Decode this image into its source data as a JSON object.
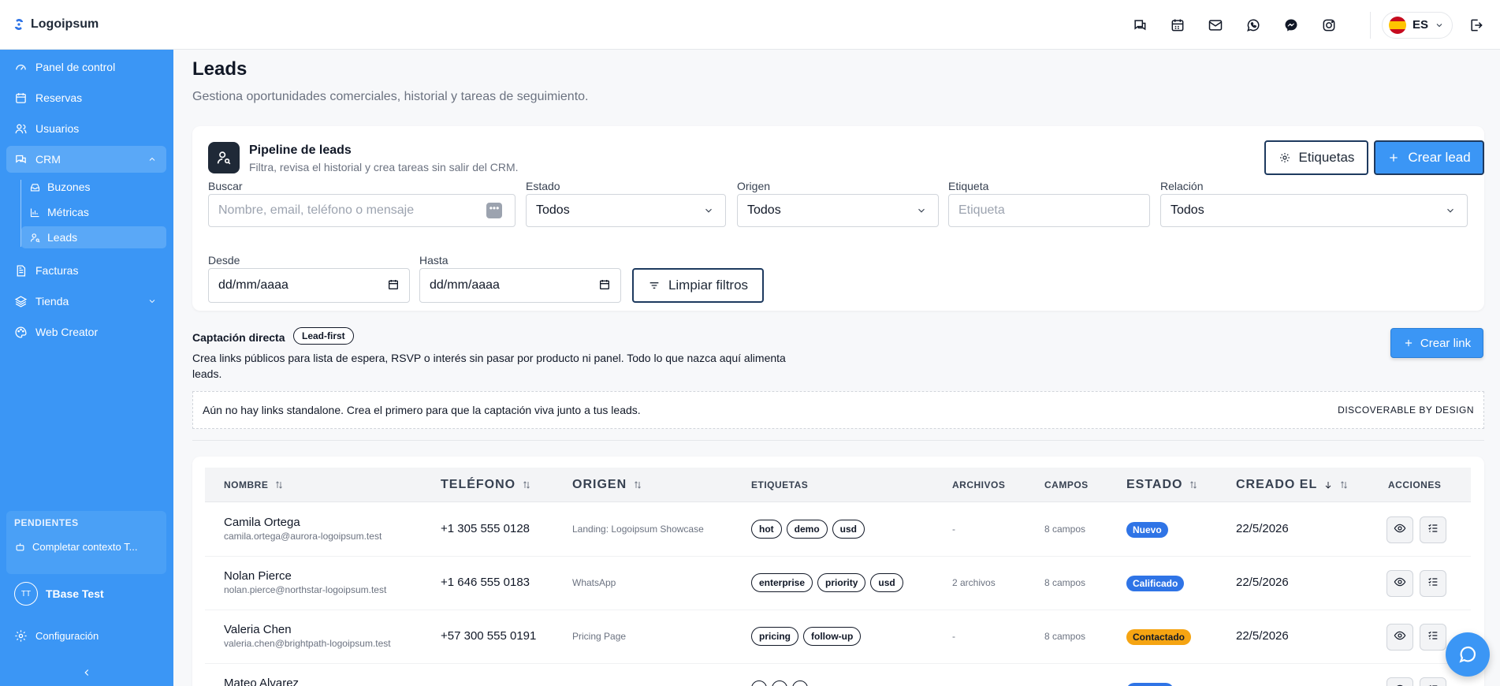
{
  "brand": {
    "name": "Logoipsum"
  },
  "topbar": {
    "icons": [
      "chat-icon",
      "calendar-icon",
      "mail-icon",
      "whatsapp-icon",
      "messenger-icon",
      "instagram-icon"
    ],
    "language": "ES"
  },
  "sidebar": {
    "items": [
      {
        "label": "Panel de control",
        "icon": "dashboard-icon"
      },
      {
        "label": "Reservas",
        "icon": "calendar-icon"
      },
      {
        "label": "Usuarios",
        "icon": "users-icon"
      },
      {
        "label": "CRM",
        "icon": "crm-icon"
      },
      {
        "label": "Facturas",
        "icon": "invoice-icon"
      },
      {
        "label": "Tienda",
        "icon": "store-icon"
      },
      {
        "label": "Web Creator",
        "icon": "palette-icon"
      }
    ],
    "crm_sub": [
      {
        "label": "Buzones"
      },
      {
        "label": "Métricas"
      },
      {
        "label": "Leads"
      }
    ],
    "pending_title": "PENDIENTES",
    "pending_item": "Completar contexto T...",
    "user_initials": "TT",
    "user_name": "TBase Test",
    "settings": "Configuración"
  },
  "page": {
    "title": "Leads",
    "subtitle": "Gestiona oportunidades comerciales, historial y tareas de seguimiento."
  },
  "pipeline": {
    "title": "Pipeline de leads",
    "subtitle": "Filtra, revisa el historial y crea tareas sin salir del CRM.",
    "tags_button": "Etiquetas",
    "create_button": "Crear lead",
    "filters": {
      "search_label": "Buscar",
      "search_placeholder": "Nombre, email, teléfono o mensaje",
      "estado_label": "Estado",
      "estado_value": "Todos",
      "origen_label": "Origen",
      "origen_value": "Todos",
      "etiqueta_label": "Etiqueta",
      "etiqueta_placeholder": "Etiqueta",
      "relacion_label": "Relación",
      "relacion_value": "Todos",
      "desde_label": "Desde",
      "desde_value": "dd/mm/aaaa",
      "hasta_label": "Hasta",
      "hasta_value": "dd/mm/aaaa",
      "clear_button": "Limpiar filtros"
    }
  },
  "captacion": {
    "title": "Captación directa",
    "badge": "Lead-first",
    "description": "Crea links públicos para lista de espera, RSVP o interés sin pasar por producto ni panel. Todo lo que nazca aquí alimenta leads.",
    "button": "Crear link",
    "empty_text": "Aún no hay links standalone. Crea el primero para que la captación viva junto a tus leads.",
    "empty_tag": "DISCOVERABLE BY DESIGN"
  },
  "table": {
    "headers": {
      "nombre": "NOMBRE",
      "telefono": "TELÉFONO",
      "origen": "ORIGEN",
      "etiquetas": "ETIQUETAS",
      "archivos": "ARCHIVOS",
      "campos": "CAMPOS",
      "estado": "ESTADO",
      "creado": "CREADO EL",
      "acciones": "ACCIONES"
    },
    "rows": [
      {
        "name": "Camila Ortega",
        "email": "camila.ortega@aurora-logoipsum.test",
        "phone": "+1 305 555 0128",
        "origin": "Landing: Logoipsum Showcase",
        "tags": [
          "hot",
          "demo",
          "usd"
        ],
        "files": "-",
        "fields": "8 campos",
        "status": "Nuevo",
        "status_color": "#2f74e6",
        "status_text_color": "#ffffff",
        "created": "22/5/2026"
      },
      {
        "name": "Nolan Pierce",
        "email": "nolan.pierce@northstar-logoipsum.test",
        "phone": "+1 646 555 0183",
        "origin": "WhatsApp",
        "tags": [
          "enterprise",
          "priority",
          "usd"
        ],
        "files": "2 archivos",
        "fields": "8 campos",
        "status": "Calificado",
        "status_color": "#2f74e6",
        "status_text_color": "#ffffff",
        "created": "22/5/2026"
      },
      {
        "name": "Valeria Chen",
        "email": "valeria.chen@brightpath-logoipsum.test",
        "phone": "+57 300 555 0191",
        "origin": "Pricing Page",
        "tags": [
          "pricing",
          "follow-up"
        ],
        "files": "-",
        "fields": "8 campos",
        "status": "Contactado",
        "status_color": "#f5a412",
        "status_text_color": "#111827",
        "created": "22/5/2026"
      },
      {
        "name": "Mateo Alvarez",
        "email": "",
        "phone": "",
        "origin": "",
        "tags": [
          "",
          "",
          ""
        ],
        "files": "",
        "fields": "",
        "status": "",
        "status_color": "#2f74e6",
        "status_text_color": "#ffffff",
        "created": ""
      }
    ]
  }
}
